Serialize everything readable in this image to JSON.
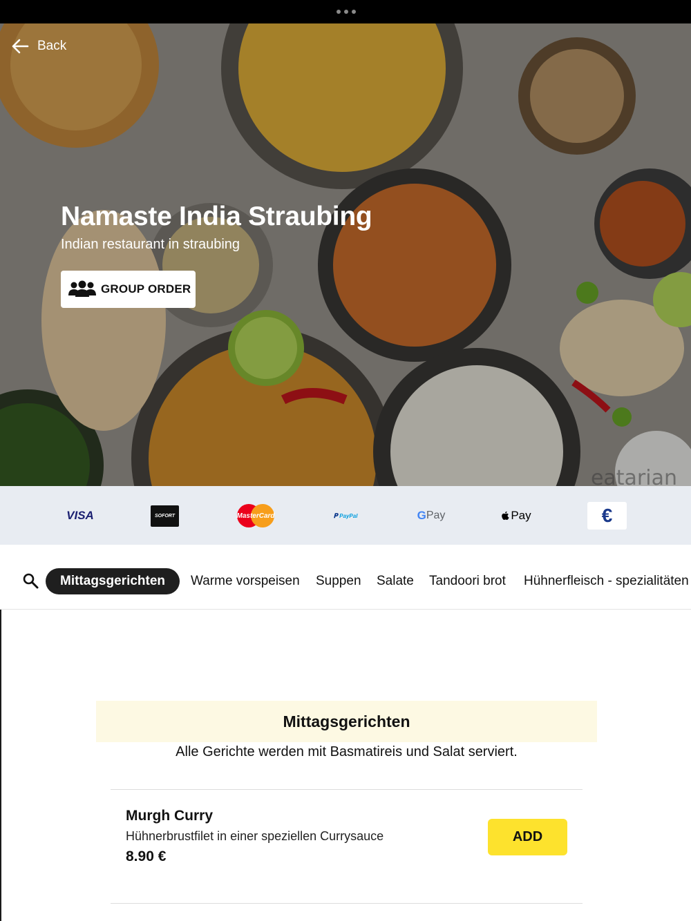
{
  "header": {
    "back_label": "Back",
    "restaurant_name": "Namaste India Straubing",
    "tagline": "Indian restaurant in straubing",
    "group_order_label": "GROUP ORDER",
    "hero_watermark": "eatarian"
  },
  "payments": {
    "visa": "VISA",
    "sofort": "SOFORT",
    "mastercard": "MasterCard",
    "paypal": "PayPal",
    "gpay": "Pay",
    "applepay": "Pay",
    "cash": "€"
  },
  "categories": [
    {
      "label": "Mittagsgerichten",
      "active": true
    },
    {
      "label": "Warme vorspeisen",
      "active": false
    },
    {
      "label": "Suppen",
      "active": false
    },
    {
      "label": "Salate",
      "active": false
    },
    {
      "label": "Tandoori brot",
      "active": false
    },
    {
      "label": "Hühnerfleisch - spezialitäten",
      "active": false
    }
  ],
  "section": {
    "title": "Mittagsgerichten",
    "description": "Alle Gerichte werden mit Basmatireis und Salat serviert."
  },
  "items": [
    {
      "name": "Murgh Curry",
      "description": "Hühnerbrustfilet in einer speziellen Currysauce",
      "price": "8.90 €",
      "add_label": "ADD"
    }
  ],
  "colors": {
    "accent_add": "#fde22d",
    "section_bg": "#fdf9e3",
    "payment_strip": "#e8ecf2",
    "active_category": "#1f1f1f"
  }
}
